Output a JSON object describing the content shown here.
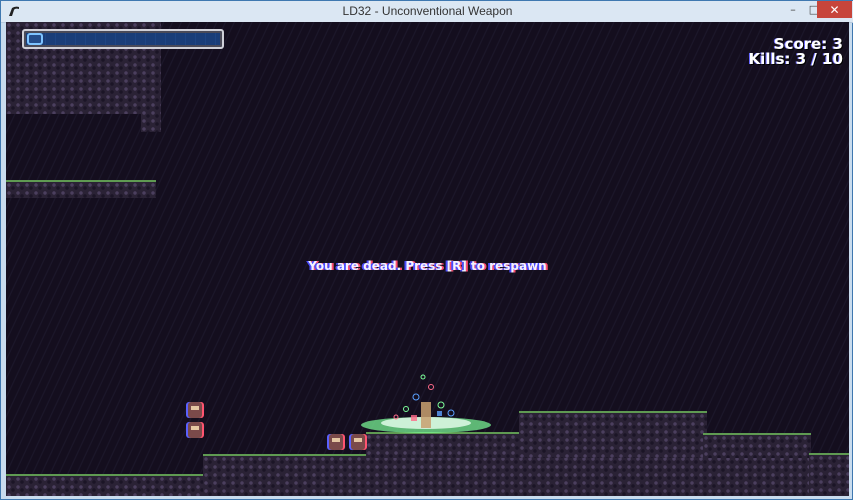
{
  "window": {
    "title": "LD32 - Unconventional Weapon",
    "buttons": {
      "minimize": "–",
      "maximize": "□",
      "close": "✕"
    }
  },
  "hud": {
    "score_text": "Score: 3",
    "kills_text": "Kills: 3 / 10"
  },
  "messages": {
    "death_text": "You are dead. Press [R] to respawn"
  },
  "colors": {
    "sky": "#140e1e",
    "ground": "#2a2235",
    "grass": "#5f9a52",
    "health_bar": "#1a3d78"
  },
  "icons": {
    "app": "app-icon",
    "hud": "health-icon"
  }
}
